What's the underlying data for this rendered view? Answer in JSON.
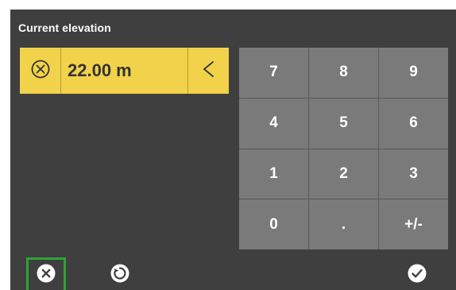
{
  "dialog": {
    "title": "Current elevation",
    "value": "22.00 m"
  },
  "icons": {
    "clear": "circle-x-icon",
    "backspace": "chevron-left-icon",
    "cancel": "filled-circle-x-icon",
    "reset": "circular-arrow-icon",
    "confirm": "filled-circle-check-icon"
  },
  "keypad": {
    "keys": [
      "7",
      "8",
      "9",
      "4",
      "5",
      "6",
      "1",
      "2",
      "3",
      "0",
      ".",
      "+/-"
    ]
  },
  "colors": {
    "background": "#3f3f3f",
    "input_yellow": "#f2d24a",
    "key_grey": "#7a7a7a",
    "focus_green": "#2ea33a"
  }
}
